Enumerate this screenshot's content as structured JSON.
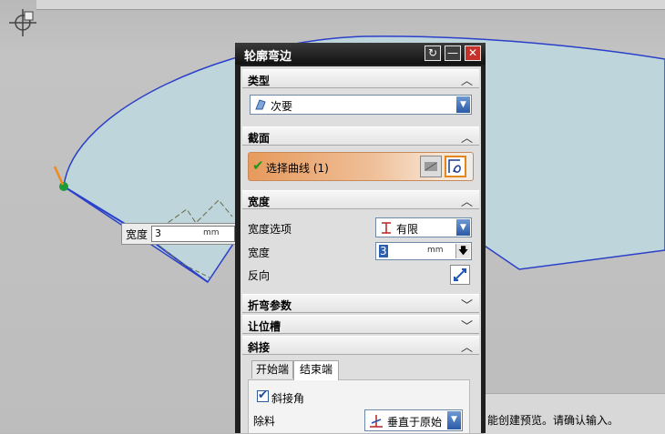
{
  "dialog": {
    "title": "轮廓弯边",
    "buttons": {
      "reset": "↻",
      "minimize": "—",
      "close": "✕"
    }
  },
  "sections": {
    "type": {
      "title": "类型",
      "selected": "次要"
    },
    "section": {
      "title": "截面",
      "select_curve": "选择曲线 (1)"
    },
    "width": {
      "title": "宽度",
      "option_label": "宽度选项",
      "option_value": "有限",
      "width_label": "宽度",
      "width_value": "3",
      "width_unit": "mm",
      "reverse_label": "反向"
    },
    "bend_params": {
      "title": "折弯参数"
    },
    "relief": {
      "title": "让位槽"
    },
    "miter": {
      "title": "斜接",
      "tabs": [
        "开始端",
        "结束端"
      ],
      "miter_angle_label": "斜接角",
      "miter_angle_checked": true,
      "remove_label": "除料",
      "remove_value": "垂直于原始"
    }
  },
  "viewport": {
    "float_width": {
      "label": "宽度",
      "value": "3",
      "unit": "mm"
    },
    "status": "能创建预览。请确认输入。"
  },
  "colors": {
    "part_fill": "#bed5db",
    "part_edge": "#2a40c8",
    "accent_orange": "#e79a5c",
    "dialog_frame": "#1f1f1f"
  }
}
